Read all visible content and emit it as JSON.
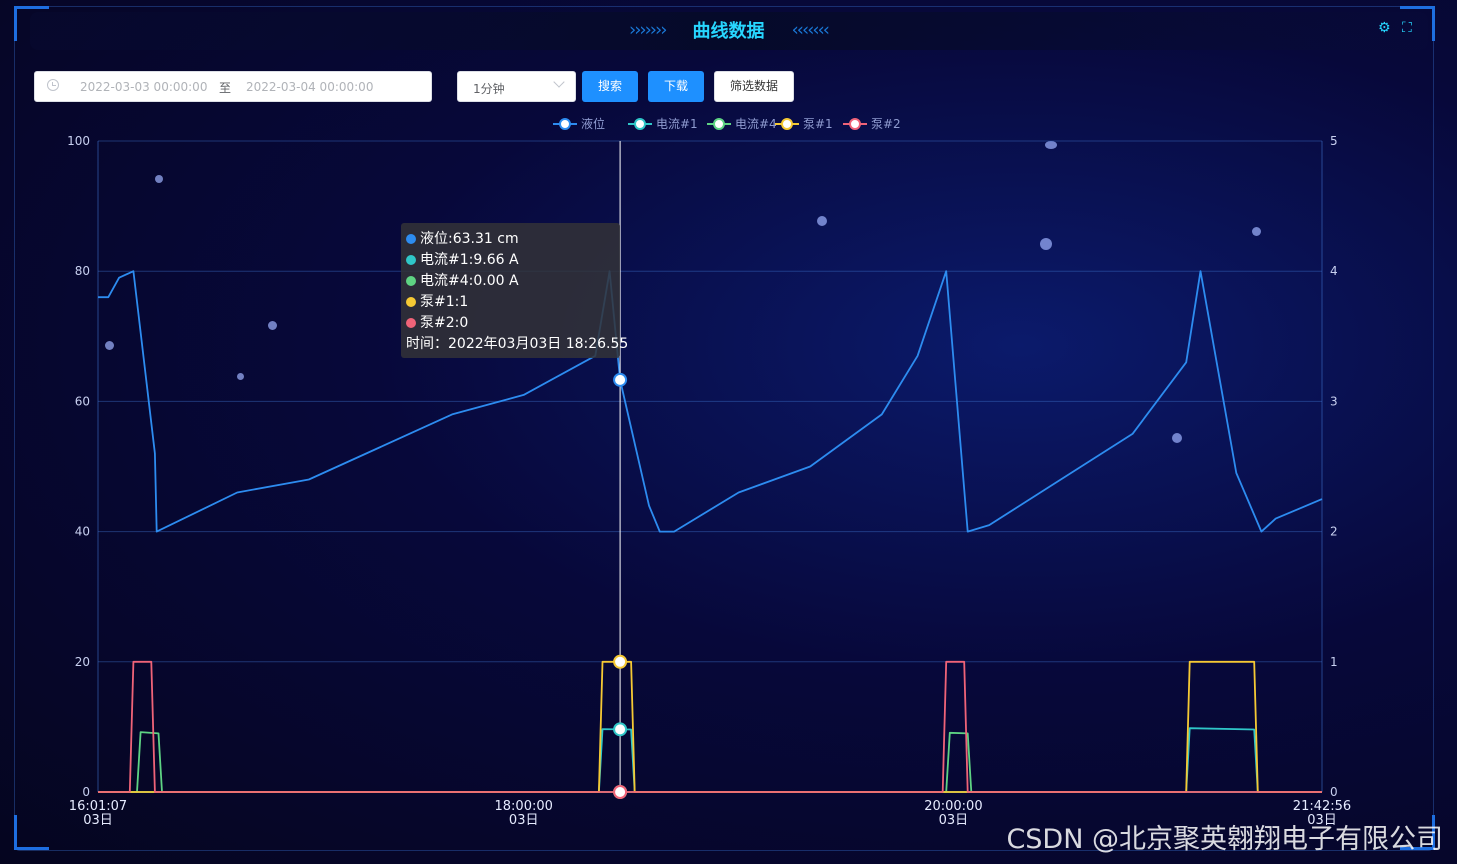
{
  "header": {
    "title": "曲线数据"
  },
  "toolbar": {
    "start_date": "2022-03-03 00:00:00",
    "separator": "至",
    "end_date": "2022-03-04 00:00:00",
    "interval": "1分钟",
    "search_label": "搜索",
    "download_label": "下载",
    "filter_label": "筛选数据"
  },
  "legend": [
    {
      "name": "液位",
      "color": "#2d8cf0"
    },
    {
      "name": "电流#1",
      "color": "#2fc6c8"
    },
    {
      "name": "电流#4",
      "color": "#5ed383"
    },
    {
      "name": "泵#1",
      "color": "#f5c934"
    },
    {
      "name": "泵#2",
      "color": "#ef6378"
    }
  ],
  "tooltip": {
    "rows": [
      {
        "text": "液位:63.31 cm",
        "color": "#2d8cf0"
      },
      {
        "text": "电流#1:9.66 A",
        "color": "#2fc6c8"
      },
      {
        "text": "电流#4:0.00 A",
        "color": "#5ed383"
      },
      {
        "text": "泵#1:1",
        "color": "#f5c934"
      },
      {
        "text": "泵#2:0",
        "color": "#ef6378"
      }
    ],
    "time": "时间：2022年03月03日 18:26.55"
  },
  "chart_data": {
    "type": "line",
    "x_range": [
      "16:01:07",
      "21:42:56"
    ],
    "x_ticks": [
      {
        "t": "16:01:07",
        "label": "16:01:07",
        "sub": "03日"
      },
      {
        "t": "18:00:00",
        "label": "18:00:00",
        "sub": "03日"
      },
      {
        "t": "20:00:00",
        "label": "20:00:00",
        "sub": "03日"
      },
      {
        "t": "21:42:56",
        "label": "21:42:56",
        "sub": "03日"
      }
    ],
    "y_left": {
      "min": 0,
      "max": 100,
      "ticks": [
        0,
        20,
        40,
        60,
        80,
        100
      ]
    },
    "y_right": {
      "min": 0,
      "max": 5,
      "ticks": [
        0,
        1,
        2,
        3,
        4,
        5
      ]
    },
    "series": [
      {
        "name": "液位",
        "axis": "left",
        "color": "#2d8cf0",
        "points": [
          [
            "16:01:07",
            76
          ],
          [
            "16:04:00",
            76
          ],
          [
            "16:07:00",
            79
          ],
          [
            "16:11:00",
            80
          ],
          [
            "16:17:00",
            52
          ],
          [
            "16:17:30",
            40
          ],
          [
            "16:40:00",
            46
          ],
          [
            "17:00:00",
            48
          ],
          [
            "17:20:00",
            53
          ],
          [
            "17:40:00",
            58
          ],
          [
            "18:00:00",
            61
          ],
          [
            "18:20:00",
            67
          ],
          [
            "18:24:00",
            80
          ],
          [
            "18:26:55",
            63.31
          ],
          [
            "18:35:00",
            44
          ],
          [
            "18:38:00",
            40
          ],
          [
            "18:42:00",
            40
          ],
          [
            "19:00:00",
            46
          ],
          [
            "19:20:00",
            50
          ],
          [
            "19:40:00",
            58
          ],
          [
            "19:50:00",
            67
          ],
          [
            "19:58:00",
            80
          ],
          [
            "20:04:00",
            40
          ],
          [
            "20:10:00",
            41
          ],
          [
            "20:30:00",
            48
          ],
          [
            "20:50:00",
            55
          ],
          [
            "21:05:00",
            66
          ],
          [
            "21:09:00",
            80
          ],
          [
            "21:19:00",
            49
          ],
          [
            "21:26:00",
            40
          ],
          [
            "21:30:00",
            42
          ],
          [
            "21:42:56",
            45
          ]
        ]
      },
      {
        "name": "电流#1",
        "axis": "left",
        "color": "#2fc6c8",
        "points": [
          [
            "16:01:07",
            0
          ],
          [
            "18:21:00",
            0
          ],
          [
            "18:22:00",
            9.66
          ],
          [
            "18:30:00",
            9.6
          ],
          [
            "18:31:00",
            0
          ],
          [
            "21:05:00",
            0
          ],
          [
            "21:06:00",
            9.8
          ],
          [
            "21:24:00",
            9.6
          ],
          [
            "21:25:00",
            0
          ],
          [
            "21:42:56",
            0
          ]
        ]
      },
      {
        "name": "电流#4",
        "axis": "left",
        "color": "#5ed383",
        "points": [
          [
            "16:01:07",
            0
          ],
          [
            "16:12:00",
            0
          ],
          [
            "16:13:00",
            9.2
          ],
          [
            "16:18:00",
            9.0
          ],
          [
            "16:19:00",
            0
          ],
          [
            "19:58:00",
            0
          ],
          [
            "19:59:00",
            9.1
          ],
          [
            "20:04:00",
            9.0
          ],
          [
            "20:05:00",
            0
          ],
          [
            "21:42:56",
            0
          ]
        ]
      },
      {
        "name": "泵#1",
        "axis": "right",
        "color": "#f5c934",
        "points": [
          [
            "16:01:07",
            0
          ],
          [
            "18:21:00",
            0
          ],
          [
            "18:22:00",
            1
          ],
          [
            "18:30:00",
            1
          ],
          [
            "18:31:00",
            0
          ],
          [
            "21:05:00",
            0
          ],
          [
            "21:06:00",
            1
          ],
          [
            "21:24:00",
            1
          ],
          [
            "21:25:00",
            0
          ],
          [
            "21:42:56",
            0
          ]
        ]
      },
      {
        "name": "泵#2",
        "axis": "right",
        "color": "#ef6378",
        "points": [
          [
            "16:01:07",
            0
          ],
          [
            "16:10:00",
            0
          ],
          [
            "16:11:00",
            1
          ],
          [
            "16:16:00",
            1
          ],
          [
            "16:17:00",
            0
          ],
          [
            "19:57:00",
            0
          ],
          [
            "19:58:00",
            1
          ],
          [
            "20:03:00",
            1
          ],
          [
            "20:04:00",
            0
          ],
          [
            "21:42:56",
            0
          ]
        ]
      }
    ],
    "cursor_time": "18:26:55",
    "grid": true,
    "legend_position": "top"
  },
  "watermark": "CSDN @北京聚英翱翔电子有限公司"
}
